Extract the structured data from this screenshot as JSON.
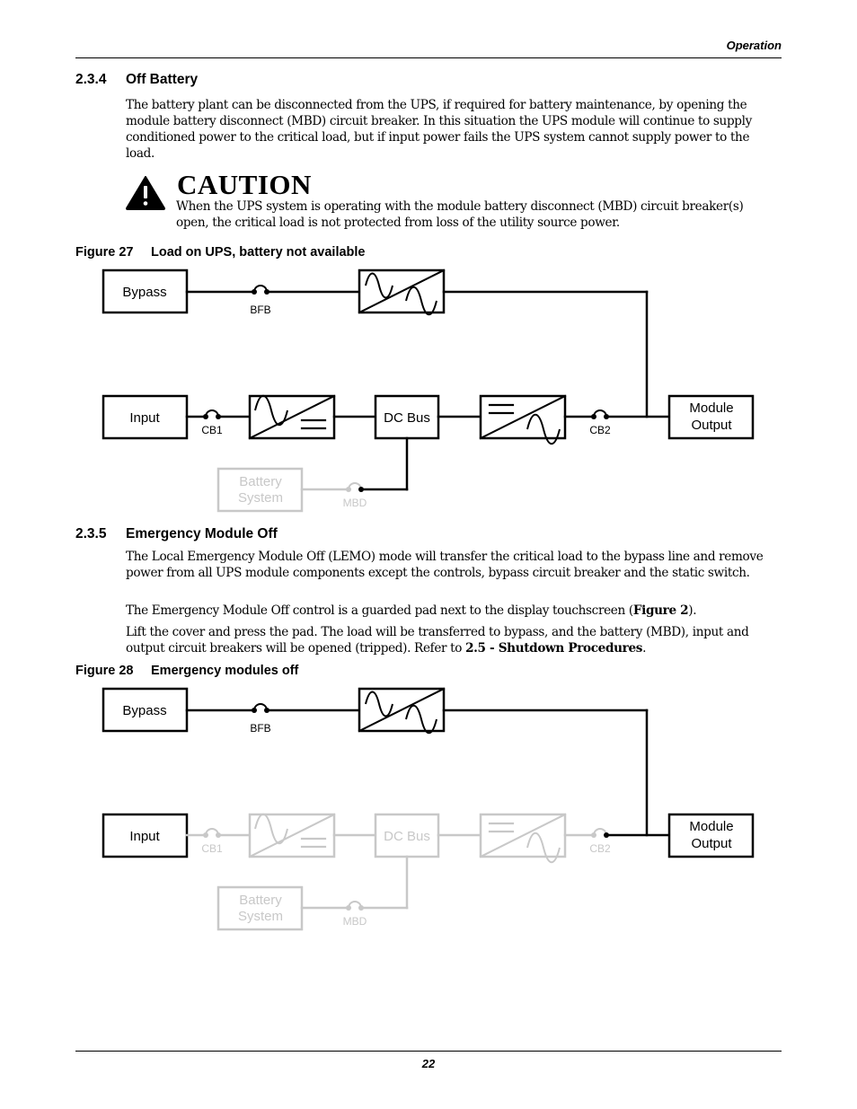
{
  "header": {
    "section": "Operation"
  },
  "section_234": {
    "number": "2.3.4",
    "title": "Off Battery",
    "paragraph": "The battery plant can be disconnected from the UPS, if required for battery maintenance, by opening the module battery disconnect (MBD) circuit breaker. In this situation the UPS module will continue to supply conditioned power to the critical load, but if input power fails the UPS system cannot supply power to the load."
  },
  "caution": {
    "icon": "warning-triangle-icon",
    "title": "CAUTION",
    "text": "When the UPS system is operating with the module battery disconnect (MBD) circuit breaker(s) open, the critical load is not protected from loss of the utility source power."
  },
  "figure27": {
    "number": "Figure 27",
    "caption": "Load on UPS, battery not available",
    "labels": {
      "bypass": "Bypass",
      "input": "Input",
      "dc_bus": "DC Bus",
      "module_output_1": "Module",
      "module_output_2": "Output",
      "battery_1": "Battery",
      "battery_2": "System",
      "bfb": "BFB",
      "cb1": "CB1",
      "cb2": "CB2",
      "mbd": "MBD"
    },
    "inactive": [
      "battery",
      "mbd-left"
    ]
  },
  "section_235": {
    "number": "2.3.5",
    "title": "Emergency Module Off",
    "paragraph1": "The Local Emergency Module Off (LEMO) mode will transfer the critical load to the bypass line and remove power from all UPS module components except the controls, bypass circuit breaker and the static switch.",
    "paragraph2_pre": "The Emergency Module Off control is a guarded pad next to the display touchscreen (",
    "paragraph2_bold": "Figure 2",
    "paragraph2_post": ").",
    "paragraph3_pre": "Lift the cover and press the pad. The load will be transferred to bypass, and the battery (MBD), input and output circuit breakers will be opened (tripped). Refer to ",
    "paragraph3_bold": "2.5 - Shutdown Procedures",
    "paragraph3_post": "."
  },
  "figure28": {
    "number": "Figure 28",
    "caption": "Emergency modules off",
    "labels": {
      "bypass": "Bypass",
      "input": "Input",
      "dc_bus": "DC Bus",
      "module_output_1": "Module",
      "module_output_2": "Output",
      "battery_1": "Battery",
      "battery_2": "System",
      "bfb": "BFB",
      "cb1": "CB1",
      "cb2": "CB2",
      "mbd": "MBD"
    },
    "inactive": [
      "cb1",
      "rectifier",
      "dc-bus",
      "inverter",
      "cb2-left",
      "battery",
      "mbd"
    ]
  },
  "colors": {
    "active": "#000000",
    "inactive": "#c8c8c8"
  },
  "footer": {
    "page_number": "22"
  }
}
